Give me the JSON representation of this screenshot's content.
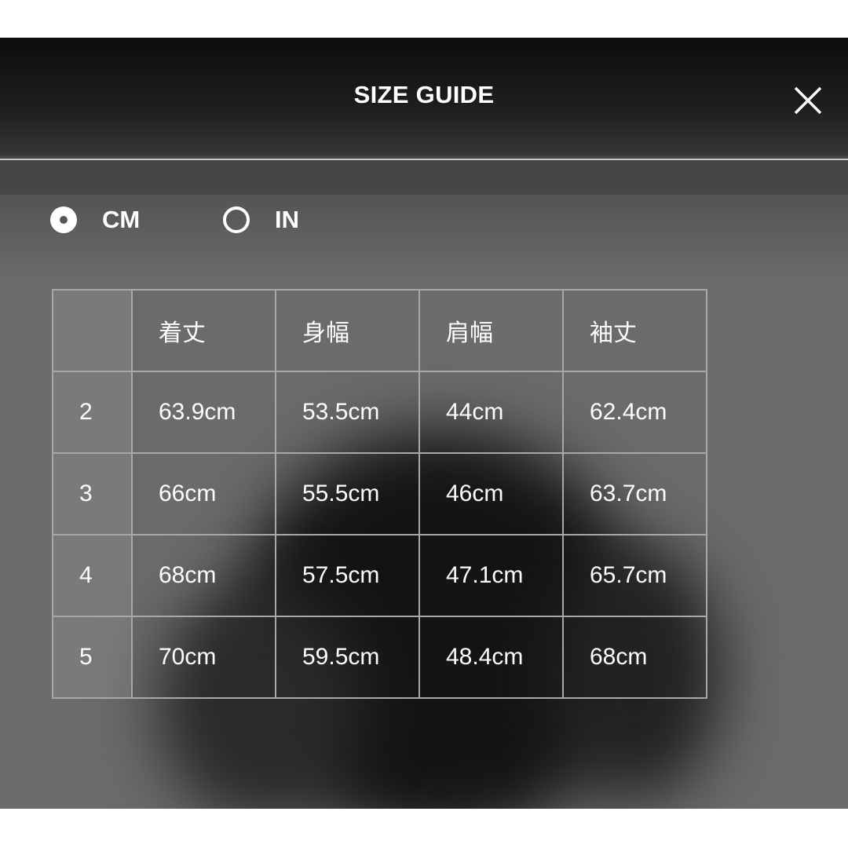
{
  "header": {
    "title": "SIZE GUIDE",
    "close_icon": "close-icon"
  },
  "units": {
    "options": [
      {
        "label": "CM",
        "selected": true
      },
      {
        "label": "IN",
        "selected": false
      }
    ]
  },
  "table": {
    "columns": [
      "",
      "着丈",
      "身幅",
      "肩幅",
      "袖丈"
    ],
    "rows": [
      {
        "size": "2",
        "values": [
          "63.9cm",
          "53.5cm",
          "44cm",
          "62.4cm"
        ]
      },
      {
        "size": "3",
        "values": [
          "66cm",
          "55.5cm",
          "46cm",
          "63.7cm"
        ]
      },
      {
        "size": "4",
        "values": [
          "68cm",
          "57.5cm",
          "47.1cm",
          "65.7cm"
        ]
      },
      {
        "size": "5",
        "values": [
          "70cm",
          "59.5cm",
          "48.4cm",
          "68cm"
        ]
      }
    ]
  },
  "colors": {
    "overlay": "#6b6b6b",
    "text": "#ffffff",
    "grid": "#a8a8a8",
    "divider": "#c9c9c9"
  }
}
